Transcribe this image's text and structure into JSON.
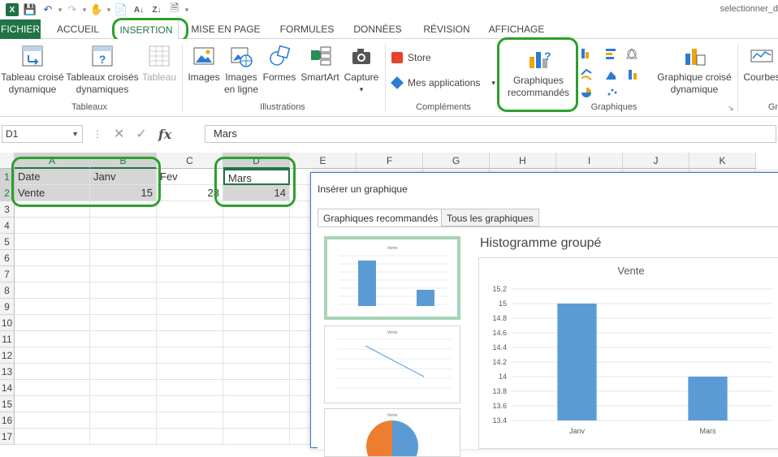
{
  "titlebar": {
    "window_title": "selectionner_d"
  },
  "tabs": {
    "file": "FICHIER",
    "accueil": "ACCUEIL",
    "insertion": "INSERTION",
    "mise_en_page": "MISE EN PAGE",
    "formules": "FORMULES",
    "donnees": "DONNÉES",
    "revision": "RÉVISION",
    "affichage": "AFFICHAGE"
  },
  "ribbon": {
    "tableau_croise": "Tableau croisé dynamique",
    "tableaux_croises": "Tableaux croisés dynamiques",
    "tableau": "Tableau",
    "group_tableaux": "Tableaux",
    "images": "Images",
    "images_en_ligne": "Images en ligne",
    "formes": "Formes",
    "smartart": "SmartArt",
    "capture": "Capture",
    "group_illustrations": "Illustrations",
    "store": "Store",
    "mes_applications": "Mes applications",
    "group_complements": "Compléments",
    "graphiques_recommandes": "Graphiques recommandés",
    "group_graphiques": "Graphiques",
    "graphique_croise": "Graphique croisé dynamique",
    "courbes": "Courbes",
    "group_trunc": "Gr"
  },
  "formula_bar": {
    "name_box": "D1",
    "formula": "Mars"
  },
  "grid": {
    "columns": [
      "A",
      "B",
      "C",
      "D",
      "E",
      "F",
      "G",
      "H",
      "I",
      "J",
      "K"
    ],
    "rows": [
      "1",
      "2",
      "3",
      "4",
      "5",
      "6",
      "7",
      "8",
      "9",
      "10",
      "11",
      "12",
      "13",
      "14",
      "15",
      "16",
      "17"
    ],
    "cells": {
      "A1": "Date",
      "B1": "Janv",
      "C1": "Fev",
      "D1": "Mars",
      "A2": "Vente",
      "B2": "15",
      "C2": "23",
      "D2": "14"
    }
  },
  "dialog": {
    "title": "Insérer un graphique",
    "tab_recommended": "Graphiques recommandés",
    "tab_all": "Tous les graphiques",
    "preview_title": "Histogramme groupé"
  },
  "chart_data": {
    "type": "bar",
    "title": "Vente",
    "categories": [
      "Janv",
      "Mars"
    ],
    "values": [
      15,
      14
    ],
    "ylim": [
      13.4,
      15.2
    ],
    "yticks": [
      "15.2",
      "15",
      "14.8",
      "14.6",
      "14.4",
      "14.2",
      "14",
      "13.8",
      "13.6",
      "13.4"
    ],
    "bar_color": "#5b9bd5",
    "grid": true
  },
  "colors": {
    "excel_green": "#217346",
    "highlight": "#2ca02c",
    "selection_shade": "#d6d6d6"
  }
}
